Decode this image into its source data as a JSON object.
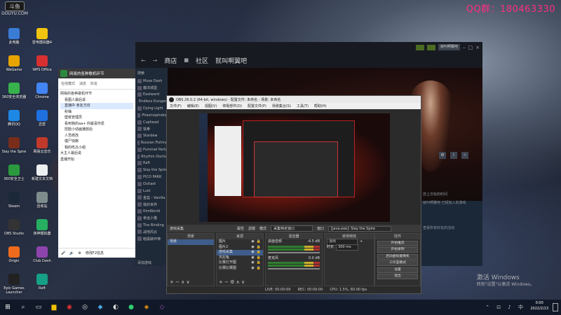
{
  "branding": {
    "logo": "斗鱼",
    "url": "DOUYU.COM",
    "contact": "QQ群：180463330"
  },
  "desktop_icons": [
    {
      "label": "此电脑",
      "color": "#3a7bd5"
    },
    {
      "label": "WeGame",
      "color": "#e6a400"
    },
    {
      "label": "360安全浏览器",
      "color": "#37b24d"
    },
    {
      "label": "腾讯QQ",
      "color": "#1e88e5"
    },
    {
      "label": "Slay the Spire",
      "color": "#7a2d1b"
    },
    {
      "label": "360安全卫士",
      "color": "#2b9a3e"
    },
    {
      "label": "Steam",
      "color": "#1b2838"
    },
    {
      "label": "OBS Studio",
      "color": "#333333"
    },
    {
      "label": "Origin",
      "color": "#f06a1d"
    },
    {
      "label": "Epic Games Launcher",
      "color": "#222222"
    },
    {
      "label": "雷电模拟器4",
      "color": "#f1c40f"
    },
    {
      "label": "WPS Office",
      "color": "#d63031"
    },
    {
      "label": "Chrome",
      "color": "#4285f4"
    },
    {
      "label": "迅雷",
      "color": "#1e6fe0"
    },
    {
      "label": "网易云音乐",
      "color": "#c0392b"
    },
    {
      "label": "新建文本文档",
      "color": "#ecf0f1"
    },
    {
      "label": "回收站",
      "color": "#7f8c8d"
    },
    {
      "label": "夜神模拟器",
      "color": "#27ae60"
    },
    {
      "label": "Club Dash",
      "color": "#8e44ad"
    },
    {
      "label": "Raft",
      "color": "#16a085"
    }
  ],
  "qq_panel": {
    "header": "网易的各种歌机环节",
    "sub_tabs": [
      "在线模式",
      "消息",
      "好友"
    ],
    "tree": [
      "网易的各种歌机环节",
      "看图人最后说",
      "直播中 亲友方坊",
      "秋柚",
      "壁纸管理员",
      "看到我的aa+ 你最喜你爱",
      "控脸小动画播放后",
      "人员修改",
      "僵尸快跑",
      "我的吃瓜小组",
      "大主人最后说",
      "直播开始"
    ],
    "footer": "修改F2信息"
  },
  "steam": {
    "nav": [
      "商店",
      "社区",
      "就叫啊翼吧"
    ],
    "user_badge": "就叫啊翼吧",
    "search": "搜索",
    "library": [
      "Muse Dash",
      "魔法城堡",
      "Eastward",
      "Endless Dungeon",
      "Dying Light",
      "Phasmophobia",
      "Cuphead",
      "铁拳",
      "Stardew",
      "Russian Fishing",
      "Pummel Party",
      "Rhythm Doctor",
      "Raft",
      "Slay the Spire",
      "PICO PARK",
      "Outlast",
      "Lust",
      "金篮 - Vanilla",
      "我的世界",
      "RimWorld",
      "幸运小猫",
      "The Binding",
      "战地风云",
      "暗黑破坏神"
    ],
    "bottom_link": "添加游戏",
    "right_texts": [
      "您上次玩的时间",
      "就叫啊翼吧 已经加入的游戏",
      "查看所有好友的活动"
    ]
  },
  "obs": {
    "title": "OBS 26.0.2 (64-bit, windows) - 配置文件: 未命名 - 场景: 未命名",
    "menu": [
      "文件(F)",
      "编辑(E)",
      "视图(V)",
      "停靠部件(D)",
      "配置文件(P)",
      "场景集合(S)",
      "工具(T)",
      "帮助(H)"
    ],
    "source_bar": {
      "label": "游戏采集",
      "props": "属性",
      "filter": "滤镜",
      "mode_label": "模式",
      "mode_value": "采集特定窗口",
      "window_label": "窗口",
      "window_value": "[java.exe]: Slay the Spire"
    },
    "scenes_title": "场景",
    "scenes": [
      "场景"
    ],
    "sources_title": "来源",
    "sources": [
      "图片",
      "图片2",
      "游戏采集",
      "杰尼龟",
      "比赛打开图",
      "比赛比赛图"
    ],
    "mixer_title": "混音器",
    "mixer": [
      {
        "name": "桌面音频",
        "db": "-4.5 dB"
      },
      {
        "name": "麦克风",
        "db": "0.0 dB"
      }
    ],
    "transitions_title": "转场特效",
    "transition_value": "淡出",
    "duration_label": "时长",
    "duration_value": "300 ms",
    "controls_title": "控件",
    "controls": [
      "开始推流",
      "开始录制",
      "启动虚拟摄像机",
      "工作室模式",
      "设置",
      "退出"
    ],
    "status": {
      "live": "LIVE: 00:00:00",
      "rec": "REC: 00:00:00",
      "cpu": "CPU: 1.5%, 60.00 fps"
    }
  },
  "taskbar": {
    "time": "0:00",
    "date": "2022/2/13"
  },
  "windows_activation": {
    "title": "激活 Windows",
    "subtitle": "转到\"设置\"以激活 Windows。"
  }
}
